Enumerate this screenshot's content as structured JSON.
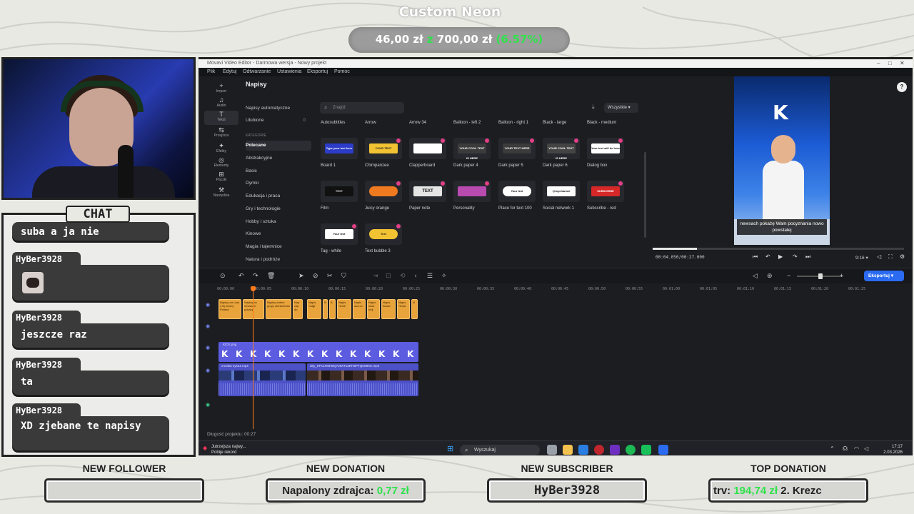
{
  "overlay": {
    "goal_title": "Custom Neon",
    "goal_current": "46,00 zł",
    "goal_sep": "z",
    "goal_target": "700,00 zł",
    "goal_percent": "(6.57%)",
    "goal_progress_fraction": 0.0657,
    "chat_label": "CHAT",
    "chat_messages": [
      {
        "user": "",
        "text": "suba a ja nie"
      },
      {
        "user": "HyBer3928",
        "text": ""
      },
      {
        "user": "HyBer3928",
        "text": "jeszcze raz"
      },
      {
        "user": "HyBer3928",
        "text": "ta"
      },
      {
        "user": "HyBer3928",
        "text": "XD zjebane te napisy"
      }
    ],
    "alerts": {
      "follower_label": "NEW FOLLOWER",
      "follower_value": "",
      "donation_label": "NEW DONATION",
      "donation_name": "Napalony zdrajca:",
      "donation_amount": "0,77 zł",
      "subscriber_label": "NEW SUBSCRIBER",
      "subscriber_value": "HyBer3928",
      "top_label": "TOP DONATION",
      "top_prefix": "trv:",
      "top_amount": "194,74 zł",
      "top_suffix": "2. Krezc"
    }
  },
  "editor": {
    "window_title": "Movavi Video Editor - Darmowa wersja - Nowy projekt",
    "menu": [
      "Plik",
      "Edytuj",
      "Odtwarzanie",
      "Ustawienia",
      "Eksportuj",
      "Pomoc"
    ],
    "tools": [
      {
        "label": "Import",
        "icon": "+"
      },
      {
        "label": "Audio",
        "icon": "♫"
      },
      {
        "label": "Tekst",
        "icon": "T"
      },
      {
        "label": "Przejścia",
        "icon": "⇆"
      },
      {
        "label": "Efekty",
        "icon": "✦"
      },
      {
        "label": "Elementy",
        "icon": "◎"
      },
      {
        "label": "Paczki",
        "icon": "⊞"
      },
      {
        "label": "Narzędzia",
        "icon": "⚒"
      }
    ],
    "panel_title": "Napisy",
    "categories_top": [
      {
        "label": "Napisy automatyczne",
        "count": ""
      },
      {
        "label": "Ulubione",
        "count": "0"
      }
    ],
    "categories_heading": "KATEGORIE",
    "categories": [
      "Polecane",
      "Abstrakcyjne",
      "Basic",
      "Dymki",
      "Edukacja i praca",
      "Gry i technologie",
      "Hobby i sztuka",
      "Kinowe",
      "Magia i tajemnice",
      "Natura i podróże"
    ],
    "search_placeholder": "Znajdź",
    "filter_label": "Wszystkie",
    "row_headers": [
      "Autosubtitles",
      "Arrow",
      "Arrow 34",
      "Balloon - left 2",
      "Balloon - right 1",
      "Black - large",
      "Black - medium"
    ],
    "tiles_row1": [
      "Board 1",
      "Chimpanzee",
      "Clapperboard",
      "Dark paper 4",
      "Dark paper 5",
      "Dark paper 6",
      "Dialog box"
    ],
    "tiles_row2": [
      "Film",
      "Juicy orange",
      "Paper note",
      "Personality",
      "Place for text 100",
      "Social network 1",
      "Subscribe - red"
    ],
    "tiles_row3": [
      "Tag - white",
      "Text bubble 3"
    ],
    "tile_texts": {
      "board": "Type your text here",
      "chimp": "YOUR TEXT",
      "dark4": "YOUR COOL TEXT IS HERE",
      "dark5": "YOUR TEXT HERE",
      "dark6": "YOUR COOL TEXT IS HERE",
      "dialog": "Your text will be here",
      "film": "TEXT",
      "paper": "TEXT",
      "place": "Your text",
      "social": "@mychannel",
      "subscribe": "SUBSCRIBE",
      "tag": "Your text",
      "bubble": "Text"
    },
    "preview_subtitle": "newsach pokażę Wam pocyznania nowo powstałej",
    "preview_time": "00:04.050/00:27.000",
    "preview_ratio": "9:16",
    "export_label": "Eksportuj",
    "ruler": [
      "00:00:00",
      "00:00:05",
      "00:00:10",
      "00:00:15",
      "00:00:20",
      "00:00:25",
      "00:00:30",
      "00:00:35",
      "00:00:40",
      "00:00:45",
      "00:00:50",
      "00:00:55",
      "00:01:00",
      "00:01:05",
      "00:01:10",
      "00:01:15",
      "00:01:20",
      "00:01:25"
    ],
    "text_clips": [
      "Napisy au Lasz z tej strony Poland",
      "Napisy au newsach pokażę",
      "Napisy autom grupy streamerów",
      "Nap zap do",
      "Napis *odgł",
      "N",
      "A",
      "Napis *śmie",
      "Napis ava co",
      "Napis nasz mój",
      "Napis Awaw",
      "Napis *śmia",
      "N"
    ],
    "image_clip_label": "KICK.png",
    "video_clip1_label": "zrzutka nysa1.mp4",
    "video_clip2_label": "aby_8TKJXMHBQ7J5XT1ZRH6PTQ0S9KK.mp4",
    "project_length": "Długość projektu: 00:27"
  },
  "taskbar": {
    "news_title": "Jutrzejsza najwy...",
    "news_sub": "Pobije rekord",
    "search_label": "Wyszukaj",
    "time": "17:17",
    "date": "2.03.2026"
  }
}
